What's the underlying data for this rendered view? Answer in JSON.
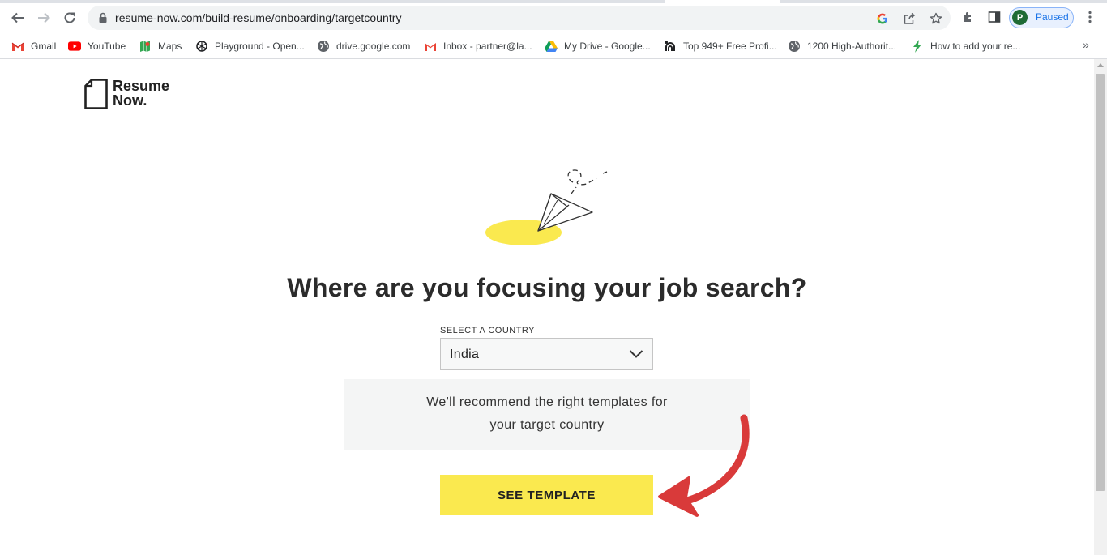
{
  "browser": {
    "url": "resume-now.com/build-resume/onboarding/targetcountry",
    "profile_initial": "P",
    "profile_status": "Paused",
    "bookmarks": [
      {
        "label": "Gmail",
        "icon": "gmail-icon"
      },
      {
        "label": "YouTube",
        "icon": "youtube-icon"
      },
      {
        "label": "Maps",
        "icon": "maps-icon"
      },
      {
        "label": "Playground - Open...",
        "icon": "openai-icon"
      },
      {
        "label": "drive.google.com",
        "icon": "globe-icon"
      },
      {
        "label": "Inbox - partner@la...",
        "icon": "gmail-icon"
      },
      {
        "label": "My Drive - Google...",
        "icon": "drive-icon"
      },
      {
        "label": "Top 949+ Free Profi...",
        "icon": "bookmark-site-icon"
      },
      {
        "label": "1200 High-Authorit...",
        "icon": "globe-icon"
      },
      {
        "label": "How to add your re...",
        "icon": "bolt-icon"
      }
    ]
  },
  "page": {
    "logo": {
      "line1": "Resume",
      "line2": "Now."
    },
    "heading": "Where are you focusing your job search?",
    "country_select": {
      "label": "SELECT A COUNTRY",
      "value": "India"
    },
    "info_text": {
      "line1": "We'll recommend the right templates for",
      "line2": "your target country"
    },
    "cta_label": "SEE TEMPLATE"
  },
  "colors": {
    "accent_yellow": "#fae94f",
    "annotation_arrow": "#d93a3a"
  }
}
